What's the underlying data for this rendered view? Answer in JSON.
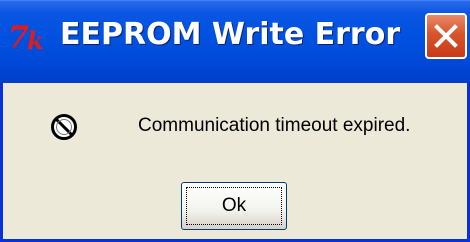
{
  "window": {
    "title": "EEPROM Write Error",
    "app_icon": "7k-logo-icon",
    "close_icon": "close-icon"
  },
  "dialog": {
    "icon": "stop-icon",
    "message": "Communication timeout expired.",
    "ok_label": "Ok"
  },
  "colors": {
    "titlebar": "#0052e0",
    "close_button": "#d8542c",
    "dialog_background": "#ece9d8",
    "app_icon_red": "#e21b1b"
  }
}
